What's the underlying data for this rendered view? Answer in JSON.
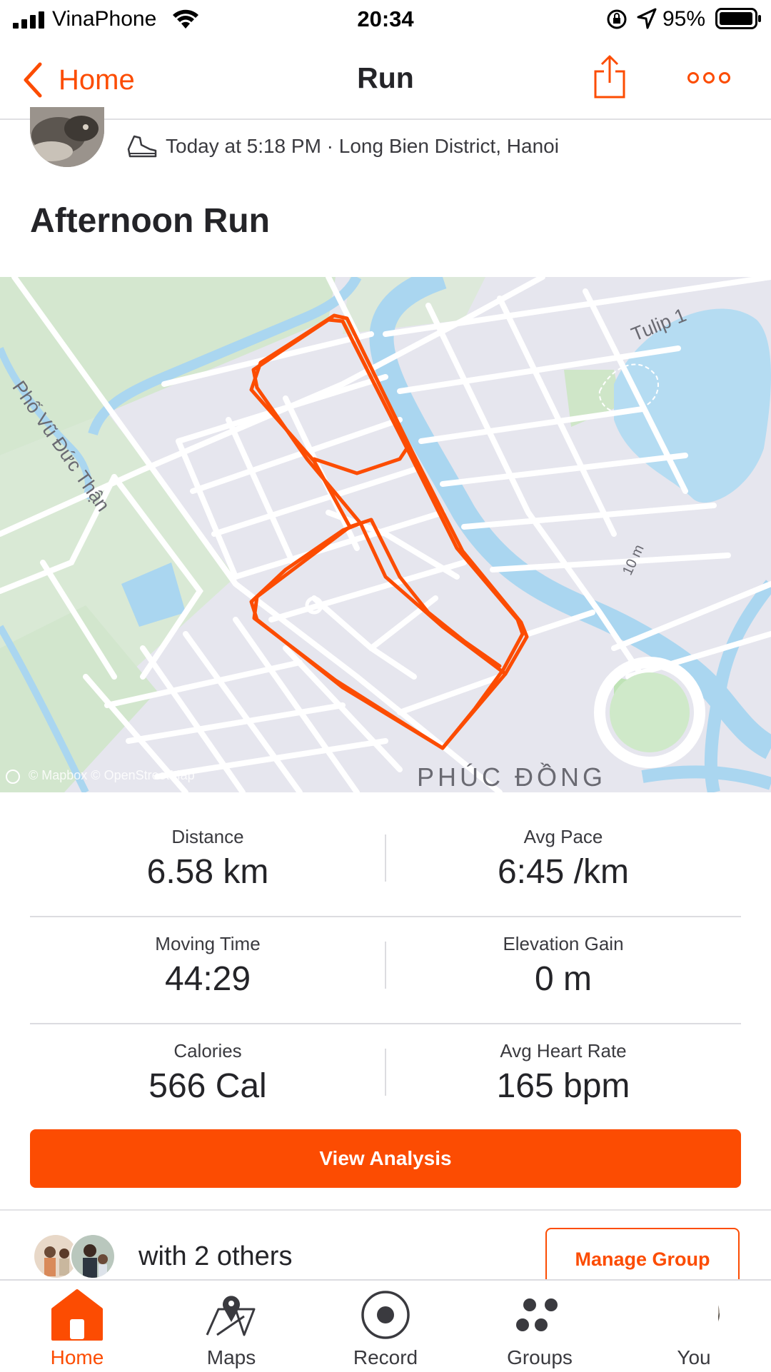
{
  "status_bar": {
    "carrier": "VinaPhone",
    "time": "20:34",
    "battery": "95%"
  },
  "nav": {
    "back_label": "Home",
    "title": "Run",
    "icons": [
      "chevron-left-icon",
      "share-icon",
      "more-icon"
    ]
  },
  "activity": {
    "meta": "Today at 5:18 PM · Long Bien District, Hanoi",
    "title": "Afternoon Run",
    "icon": "shoe-icon"
  },
  "map": {
    "labels": {
      "street_1": "Phố Vũ Đức Thận",
      "street_2": "Tulip 1",
      "street_3": "10 m",
      "district": "PHÚC ĐỒNG"
    },
    "attribution": "© Mapbox © OpenStreetMap",
    "route_color": "#fc4c02"
  },
  "stats": [
    [
      {
        "label": "Distance",
        "value": "6.58 km"
      },
      {
        "label": "Avg Pace",
        "value": "6:45 /km"
      }
    ],
    [
      {
        "label": "Moving Time",
        "value": "44:29"
      },
      {
        "label": "Elevation Gain",
        "value": "0 m"
      }
    ],
    [
      {
        "label": "Calories",
        "value": "566 Cal"
      },
      {
        "label": "Avg Heart Rate",
        "value": "165 bpm"
      }
    ]
  ],
  "actions": {
    "view_analysis": "View Analysis",
    "group_text": "with 2 others",
    "manage_group": "Manage Group"
  },
  "tabs": [
    {
      "label": "Home",
      "icon": "home-icon",
      "active": true
    },
    {
      "label": "Maps",
      "icon": "map-pin-icon",
      "active": false
    },
    {
      "label": "Record",
      "icon": "record-icon",
      "active": false
    },
    {
      "label": "Groups",
      "icon": "groups-icon",
      "active": false
    },
    {
      "label": "You",
      "icon": "avatar",
      "active": false
    }
  ],
  "colors": {
    "accent": "#fc4c02",
    "text": "#242428",
    "water": "#b6dcf0",
    "park": "#d3e8d0"
  }
}
